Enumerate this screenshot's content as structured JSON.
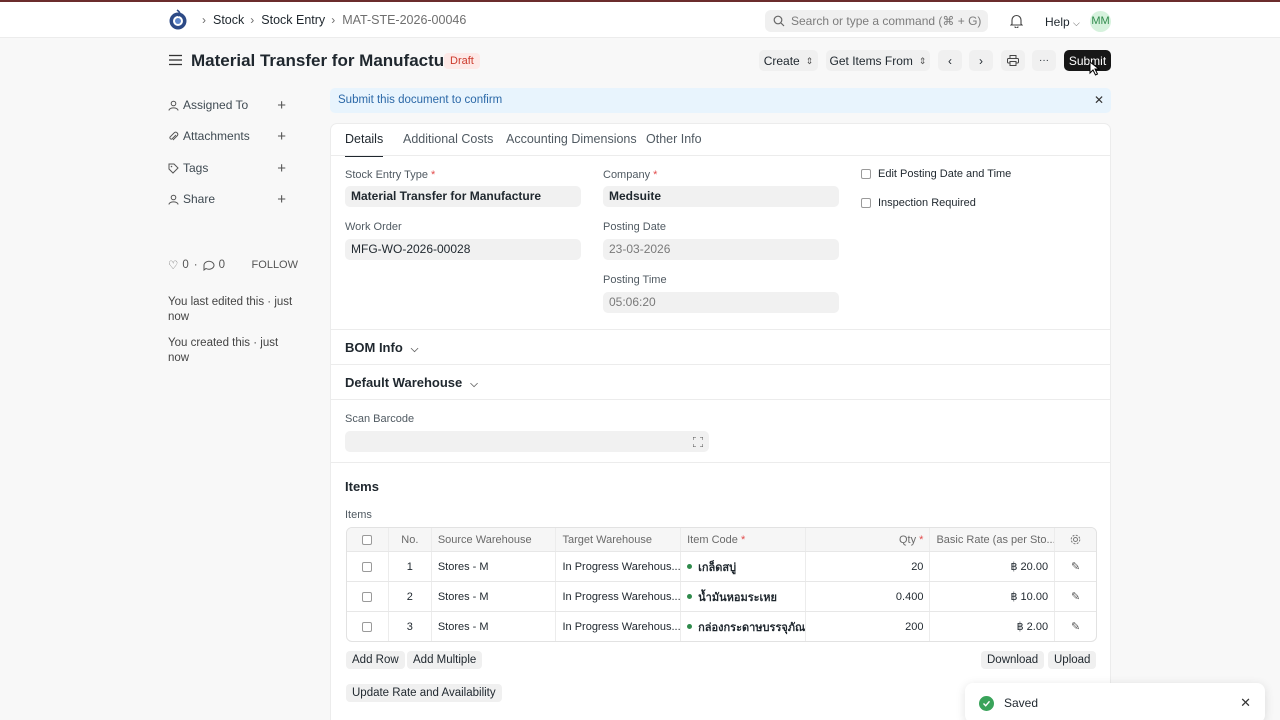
{
  "breadcrumbs": [
    "Stock",
    "Stock Entry",
    "MAT-STE-2026-00046"
  ],
  "search": {
    "placeholder": "Search or type a command (⌘ + G)"
  },
  "help_label": "Help",
  "user_initials": "MM",
  "page": {
    "title": "Material Transfer for Manufacture",
    "status": "Draft"
  },
  "actions": {
    "create": "Create",
    "get_items": "Get Items From",
    "more": "···",
    "submit": "Submit"
  },
  "sidebar": {
    "items": [
      {
        "label": "Assigned To",
        "icon": "user-icon"
      },
      {
        "label": "Attachments",
        "icon": "paperclip-icon"
      },
      {
        "label": "Tags",
        "icon": "tag-icon"
      },
      {
        "label": "Share",
        "icon": "share-icon"
      }
    ],
    "likes": "0",
    "comments": "0",
    "follow": "FOLLOW",
    "last_edited": "You last edited this · just now",
    "created": "You created this · just now"
  },
  "alert": {
    "text": "Submit this document to confirm",
    "close": "✕"
  },
  "tabs": [
    "Details",
    "Additional Costs",
    "Accounting Dimensions",
    "Other Info"
  ],
  "form": {
    "stock_entry_type_label": "Stock Entry Type",
    "stock_entry_type": "Material Transfer for Manufacture",
    "work_order_label": "Work Order",
    "work_order": "MFG-WO-2026-00028",
    "company_label": "Company",
    "company": "Medsuite",
    "posting_date_label": "Posting Date",
    "posting_date": "23-03-2026",
    "posting_time_label": "Posting Time",
    "posting_time": "05:06:20",
    "edit_posting_label": "Edit Posting Date and Time",
    "inspection_label": "Inspection Required",
    "required_mark": "*"
  },
  "sections": {
    "bom_info": "BOM Info",
    "default_warehouse": "Default Warehouse",
    "items": "Items"
  },
  "scan_barcode_label": "Scan Barcode",
  "items_table": {
    "label": "Items",
    "headers": {
      "no": "No.",
      "source": "Source Warehouse",
      "target": "Target Warehouse",
      "item_code": "Item Code",
      "qty": "Qty",
      "rate": "Basic Rate (as per Sto..."
    },
    "rows": [
      {
        "no": "1",
        "source": "Stores - M",
        "target": "In Progress Warehous...",
        "item_code": "เกล็ดสบู่",
        "qty": "20",
        "rate": "฿ 20.00"
      },
      {
        "no": "2",
        "source": "Stores - M",
        "target": "In Progress Warehous...",
        "item_code": "น้ำมันหอมระเหย",
        "qty": "0.400",
        "rate": "฿ 10.00"
      },
      {
        "no": "3",
        "source": "Stores - M",
        "target": "In Progress Warehous...",
        "item_code": "กล่องกระดาษบรรจุภัณฑ์",
        "qty": "200",
        "rate": "฿ 2.00"
      }
    ],
    "add_row": "Add Row",
    "add_multiple": "Add Multiple",
    "download": "Download",
    "upload": "Upload",
    "update_rate": "Update Rate and Availability"
  },
  "toast": {
    "message": "Saved",
    "close": "✕"
  },
  "colors": {
    "draft_badge": "#cc3a2c",
    "alert_text": "#2b68a7",
    "success": "#39a35a"
  }
}
